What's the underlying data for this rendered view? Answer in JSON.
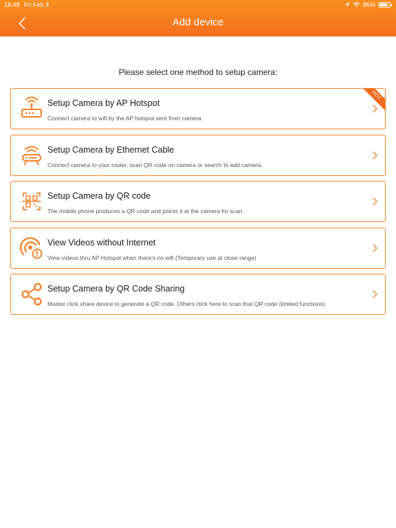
{
  "status_bar": {
    "time": "18:48",
    "date": "Fri Feb 3",
    "battery": "86%"
  },
  "header": {
    "title": "Add device",
    "back_icon": "chevron-left-icon"
  },
  "instruction": "Please select one method to setup camera:",
  "colors": {
    "accent": "#f5822a",
    "header_top": "#f7901e",
    "header_bottom": "#f66d1c"
  },
  "methods": [
    {
      "title": "Setup Camera by AP Hotspot",
      "description": "Connect camera to wifi by the AP hotspot sent from camera",
      "icon": "router-icon",
      "badge": "HOT"
    },
    {
      "title": "Setup Camera by Ethernet Cable",
      "description": "Connect camera to your router, scan QR code on camera or search to add camera.",
      "icon": "ethernet-icon"
    },
    {
      "title": "Setup Camera by QR code",
      "description": "The mobile phone produces a QR code and points it at the camera for scan",
      "icon": "qr-scan-icon"
    },
    {
      "title": "View Videos without Internet",
      "description": "View videos thru AP Hotspot when there's no wifi (Temporary use at close range)",
      "icon": "offline-signal-icon"
    },
    {
      "title": "Setup Camera by QR Code Sharing",
      "description": "Master click share device to generate a QR code. Others click here to scan that QR code (limited functions).",
      "icon": "share-icon"
    }
  ]
}
